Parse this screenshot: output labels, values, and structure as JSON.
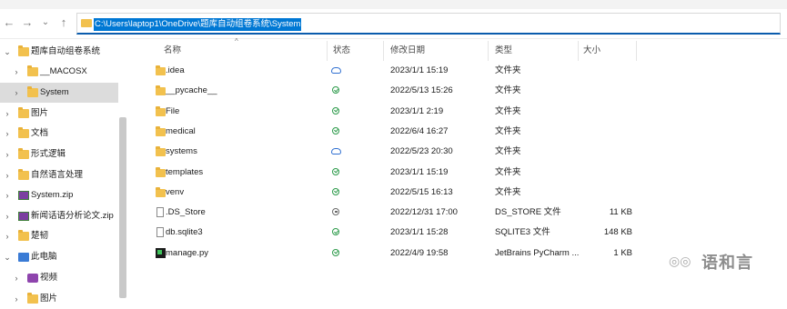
{
  "nav": {
    "back": "←",
    "forward": "→",
    "dropdown": "⌄",
    "up": "↑"
  },
  "address": {
    "path": "C:\\Users\\laptop1\\OneDrive\\题库自动组卷系统\\System"
  },
  "sidebar": {
    "items": [
      {
        "label": "题库自动组卷系统",
        "expanded": true,
        "icon": "folder-icon"
      },
      {
        "label": "__MACOSX",
        "expanded": false,
        "icon": "folder-icon"
      },
      {
        "label": "System",
        "expanded": false,
        "icon": "folder-icon",
        "selected": true
      },
      {
        "label": "图片",
        "expanded": false,
        "icon": "folder-icon"
      },
      {
        "label": "文档",
        "expanded": false,
        "icon": "folder-icon"
      },
      {
        "label": "形式逻辑",
        "expanded": false,
        "icon": "folder-icon"
      },
      {
        "label": "自然语言处理",
        "expanded": false,
        "icon": "folder-icon"
      },
      {
        "label": "System.zip",
        "expanded": false,
        "icon": "zip-icon"
      },
      {
        "label": "新闻话语分析论文.zip",
        "expanded": false,
        "icon": "zip-icon"
      },
      {
        "label": "楚韧",
        "expanded": false,
        "icon": "folder-icon"
      },
      {
        "label": "此电脑",
        "expanded": true,
        "icon": "computer-icon"
      },
      {
        "label": "视频",
        "expanded": false,
        "icon": "video-icon"
      },
      {
        "label": "图片",
        "expanded": false,
        "icon": "picture-icon"
      }
    ]
  },
  "columns": {
    "name": "名称",
    "status": "状态",
    "date": "修改日期",
    "type": "类型",
    "size": "大小"
  },
  "files": [
    {
      "name": ".idea",
      "status": "cloud",
      "date": "2023/1/1 15:19",
      "type": "文件夹",
      "size": "",
      "icon": "folder"
    },
    {
      "name": "__pycache__",
      "status": "ok",
      "date": "2022/5/13 15:26",
      "type": "文件夹",
      "size": "",
      "icon": "folder"
    },
    {
      "name": "File",
      "status": "ok",
      "date": "2023/1/1 2:19",
      "type": "文件夹",
      "size": "",
      "icon": "folder"
    },
    {
      "name": "medical",
      "status": "ok",
      "date": "2022/6/4 16:27",
      "type": "文件夹",
      "size": "",
      "icon": "folder"
    },
    {
      "name": "systems",
      "status": "cloud",
      "date": "2022/5/23 20:30",
      "type": "文件夹",
      "size": "",
      "icon": "folder"
    },
    {
      "name": "templates",
      "status": "ok",
      "date": "2023/1/1 15:19",
      "type": "文件夹",
      "size": "",
      "icon": "folder"
    },
    {
      "name": "venv",
      "status": "ok",
      "date": "2022/5/15 16:13",
      "type": "文件夹",
      "size": "",
      "icon": "folder"
    },
    {
      "name": ".DS_Store",
      "status": "sync",
      "date": "2022/12/31 17:00",
      "type": "DS_STORE 文件",
      "size": "11 KB",
      "icon": "file"
    },
    {
      "name": "db.sqlite3",
      "status": "ok",
      "date": "2023/1/1 15:28",
      "type": "SQLITE3 文件",
      "size": "148 KB",
      "icon": "file"
    },
    {
      "name": "manage.py",
      "status": "ok",
      "date": "2022/4/9 19:58",
      "type": "JetBrains PyCharm ...",
      "size": "1 KB",
      "icon": "pycharm"
    }
  ],
  "watermark": {
    "text": "语和言"
  },
  "colors": {
    "accent": "#0078d4",
    "folder": "#f2c14e",
    "ok": "#2c9a4a",
    "cloud": "#2f6fd1"
  }
}
